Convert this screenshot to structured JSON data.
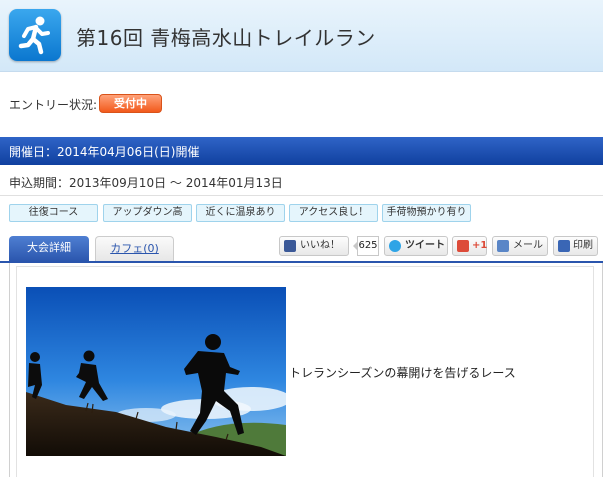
{
  "header": {
    "title": "第16回 青梅高水山トレイルラン",
    "logo_icon": "runner-icon",
    "accent": "#0b77cf"
  },
  "entry": {
    "label": "エントリー状況:",
    "status": "受付中",
    "status_color": "#f25a1c"
  },
  "event": {
    "date_text": "開催日：2014年04月06日(日)開催",
    "apply_period": "申込期間：2013年09月10日 〜 2014年01月13日"
  },
  "tags": [
    "往復コース",
    "アップダウン高",
    "近くに温泉あり",
    "アクセス良し！",
    "手荷物預かり有り"
  ],
  "tabs": {
    "details": "大会詳細",
    "cafe": "カフェ(0)"
  },
  "share": {
    "like_label": "いいね！",
    "like_count": "625",
    "tweet_label": "ツイート",
    "gplus_label": "+1",
    "mail_label": "メール",
    "print_label": "印刷"
  },
  "content": {
    "caption": "トレランシーズンの幕開けを告げるレース"
  }
}
